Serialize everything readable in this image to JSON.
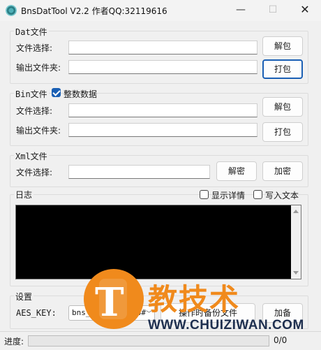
{
  "window": {
    "title": "BnsDatTool V2.2 作者QQ:32119616",
    "min_glyph": "—",
    "max_glyph": "☐",
    "close_glyph": "✕"
  },
  "dat_group": {
    "title": "Dat文件",
    "file_label": "文件选择:",
    "out_label": "输出文件夹:",
    "file_value": "",
    "out_value": "",
    "unpack_btn": "解包",
    "pack_btn": "打包"
  },
  "bin_group": {
    "title": "Bin文件",
    "checkbox_label": "整数数据",
    "checkbox_checked": true,
    "file_label": "文件选择:",
    "out_label": "输出文件夹:",
    "file_value": "",
    "out_value": "",
    "unpack_btn": "解包",
    "pack_btn": "打包"
  },
  "xml_group": {
    "title": "Xml文件",
    "file_label": "文件选择:",
    "file_value": "",
    "decrypt_btn": "解密",
    "encrypt_btn": "加密"
  },
  "log_group": {
    "title": "日志",
    "show_details_label": "显示详情",
    "write_text_label": "写入文本"
  },
  "settings_group": {
    "title": "设置",
    "aes_label": "AES_KEY:",
    "aes_value": "bns_obt_kr_2014#",
    "btn1": "操作时备份文件",
    "btn2": "加备"
  },
  "status": {
    "progress_label": "进度:",
    "progress_value": 0,
    "count_text": "0/0"
  },
  "watermark": {
    "logo_letter": "T",
    "text": "教技术",
    "url": "WWW.CHUIZIWAN.COM"
  }
}
